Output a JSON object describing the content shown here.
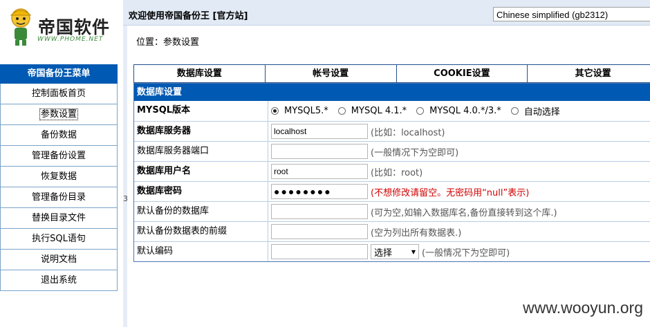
{
  "logo": {
    "brand": "帝国软件",
    "site": "WWW.PHOME.NET"
  },
  "menu": {
    "title": "帝国备份王菜单",
    "items": [
      {
        "label": "控制面板首页"
      },
      {
        "label": "参数设置",
        "active": true
      },
      {
        "label": "备份数据"
      },
      {
        "label": "管理备份设置"
      },
      {
        "label": "恢复数据"
      },
      {
        "label": "管理备份目录"
      },
      {
        "label": "替换目录文件"
      },
      {
        "label": "执行SQL语句"
      },
      {
        "label": "说明文档"
      },
      {
        "label": "退出系统"
      }
    ]
  },
  "header": {
    "welcome": "欢迎使用帝国备份王 [官方站]",
    "language": "Chinese simplified (gb2312)"
  },
  "breadcrumb": "位置：参数设置",
  "stray_char": "3",
  "tabs": [
    "数据库设置",
    "帐号设置",
    "COOKIE设置",
    "其它设置"
  ],
  "settings": {
    "section": "数据库设置",
    "mysql_version": {
      "label": "MYSQL版本",
      "options": [
        "MYSQL5.*",
        "MYSQL 4.1.*",
        "MYSQL 4.0.*/3.*",
        "自动选择"
      ],
      "selected": "MYSQL5.*"
    },
    "db_host": {
      "label": "数据库服务器",
      "value": "localhost",
      "hint": "(比如：localhost)"
    },
    "db_port": {
      "label": "数据库服务器端口",
      "value": "",
      "hint": "(一般情况下为空即可)"
    },
    "db_user": {
      "label": "数据库用户名",
      "value": "root",
      "hint": "(比如：root)"
    },
    "db_pass": {
      "label": "数据库密码",
      "value": "●●●●●●●●",
      "hint": "(不想修改请留空。无密码用“null”表示)"
    },
    "default_db": {
      "label": "默认备份的数据库",
      "value": "",
      "hint": "(可为空,如输入数据库名,备份直接转到这个库.)"
    },
    "table_prefix": {
      "label": "默认备份数据表的前缀",
      "value": "",
      "hint": "(空为列出所有数据表.)"
    },
    "charset": {
      "label": "默认编码",
      "value": "",
      "select": "选择",
      "hint": "(一般情况下为空即可)"
    }
  },
  "watermark": "www.wooyun.org"
}
